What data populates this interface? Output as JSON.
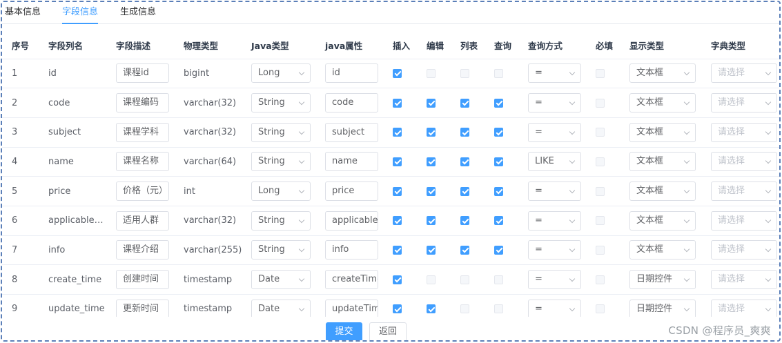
{
  "tabs": [
    "基本信息",
    "字段信息",
    "生成信息"
  ],
  "active_tab": 1,
  "columns": [
    "序号",
    "字段列名",
    "字段描述",
    "物理类型",
    "Java类型",
    "java属性",
    "插入",
    "编辑",
    "列表",
    "查询",
    "查询方式",
    "必填",
    "显示类型",
    "字典类型"
  ],
  "rows": [
    {
      "no": "1",
      "column": "id",
      "desc": "课程id",
      "phys": "bigint",
      "java_type": "Long",
      "attr": "id",
      "insert": true,
      "edit": false,
      "list": false,
      "query": false,
      "query_type": "=",
      "required": false,
      "html_type": "文本框",
      "dict": "请选择"
    },
    {
      "no": "2",
      "column": "code",
      "desc": "课程编码",
      "phys": "varchar(32)",
      "java_type": "String",
      "attr": "code",
      "insert": true,
      "edit": true,
      "list": true,
      "query": true,
      "query_type": "=",
      "required": false,
      "html_type": "文本框",
      "dict": "请选择"
    },
    {
      "no": "3",
      "column": "subject",
      "desc": "课程学科",
      "phys": "varchar(32)",
      "java_type": "String",
      "attr": "subject",
      "insert": true,
      "edit": true,
      "list": true,
      "query": true,
      "query_type": "=",
      "required": false,
      "html_type": "文本框",
      "dict": "请选择"
    },
    {
      "no": "4",
      "column": "name",
      "desc": "课程名称",
      "phys": "varchar(64)",
      "java_type": "String",
      "attr": "name",
      "insert": true,
      "edit": true,
      "list": true,
      "query": true,
      "query_type": "LIKE",
      "required": false,
      "html_type": "文本框",
      "dict": "请选择"
    },
    {
      "no": "5",
      "column": "price",
      "desc": "价格（元）",
      "phys": "int",
      "java_type": "Long",
      "attr": "price",
      "insert": true,
      "edit": true,
      "list": true,
      "query": true,
      "query_type": "=",
      "required": false,
      "html_type": "文本框",
      "dict": "请选择"
    },
    {
      "no": "6",
      "column": "applicable_…",
      "desc": "适用人群",
      "phys": "varchar(32)",
      "java_type": "String",
      "attr": "applicablel",
      "insert": true,
      "edit": true,
      "list": true,
      "query": true,
      "query_type": "=",
      "required": false,
      "html_type": "文本框",
      "dict": "请选择"
    },
    {
      "no": "7",
      "column": "info",
      "desc": "课程介绍",
      "phys": "varchar(255)",
      "java_type": "String",
      "attr": "info",
      "insert": true,
      "edit": true,
      "list": true,
      "query": true,
      "query_type": "=",
      "required": false,
      "html_type": "文本框",
      "dict": "请选择"
    },
    {
      "no": "8",
      "column": "create_time",
      "desc": "创建时间",
      "phys": "timestamp",
      "java_type": "Date",
      "attr": "createTime",
      "insert": true,
      "edit": false,
      "list": false,
      "query": false,
      "query_type": "=",
      "required": false,
      "html_type": "日期控件",
      "dict": "请选择"
    },
    {
      "no": "9",
      "column": "update_time",
      "desc": "更新时间",
      "phys": "timestamp",
      "java_type": "Date",
      "attr": "updateTim",
      "insert": true,
      "edit": true,
      "list": false,
      "query": false,
      "query_type": "=",
      "required": false,
      "html_type": "日期控件",
      "dict": "请选择"
    }
  ],
  "buttons": {
    "submit": "提交",
    "back": "返回"
  },
  "watermark": "CSDN @程序员_爽爽",
  "colors": {
    "accent": "#409eff",
    "border": "#5b7fb8"
  },
  "icons": {
    "select_arrow": "chevron-down-icon",
    "checked": "check-icon"
  }
}
